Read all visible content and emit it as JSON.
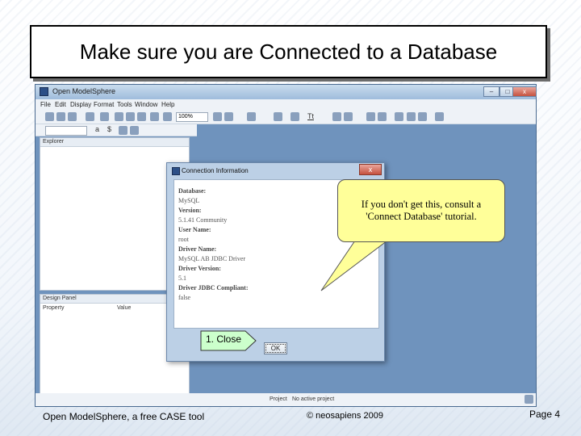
{
  "slide": {
    "title": "Make sure you are Connected to a Database",
    "footer_left": "Open ModelSphere, a free CASE tool",
    "footer_center": "© neosapiens 2009",
    "footer_right": "Page 4"
  },
  "app": {
    "title": "Open ModelSphere",
    "window_controls": {
      "minimize": "–",
      "maximize": "□",
      "close": "x"
    },
    "menu": [
      "File",
      "Edit",
      "Display",
      "Format",
      "Tools",
      "Window",
      "Help"
    ],
    "zoom": "100%",
    "toolbar_text": "Tt",
    "explorer_label": "Explorer",
    "design_panel_label": "Design Panel",
    "design_columns": [
      "Property",
      "Value"
    ],
    "status": {
      "label": "Project",
      "value": "No active project"
    }
  },
  "dialog": {
    "title": "Connection Information",
    "close": "x",
    "lines": [
      {
        "text": "Database:",
        "kind": "k"
      },
      {
        "text": "MySQL",
        "kind": "v"
      },
      {
        "text": "Version:",
        "kind": "k"
      },
      {
        "text": "5.1.41 Community",
        "kind": "v"
      },
      {
        "text": "User Name:",
        "kind": "k"
      },
      {
        "text": "root",
        "kind": "v"
      },
      {
        "text": "Driver Name:",
        "kind": "k"
      },
      {
        "text": "MySQL AB JDBC Driver",
        "kind": "v"
      },
      {
        "text": "Driver Version:",
        "kind": "k"
      },
      {
        "text": "5.1",
        "kind": "v"
      },
      {
        "text": "Driver JDBC Compliant:",
        "kind": "k"
      },
      {
        "text": "false",
        "kind": "v"
      }
    ],
    "ok_label": "OK"
  },
  "callouts": {
    "tip_line1": "If you don't get this, consult a",
    "tip_line2": "'Connect Database' tutorial.",
    "close_step": "1. Close",
    "tip_fill": "#ffff99",
    "close_fill": "#ccffcc"
  }
}
